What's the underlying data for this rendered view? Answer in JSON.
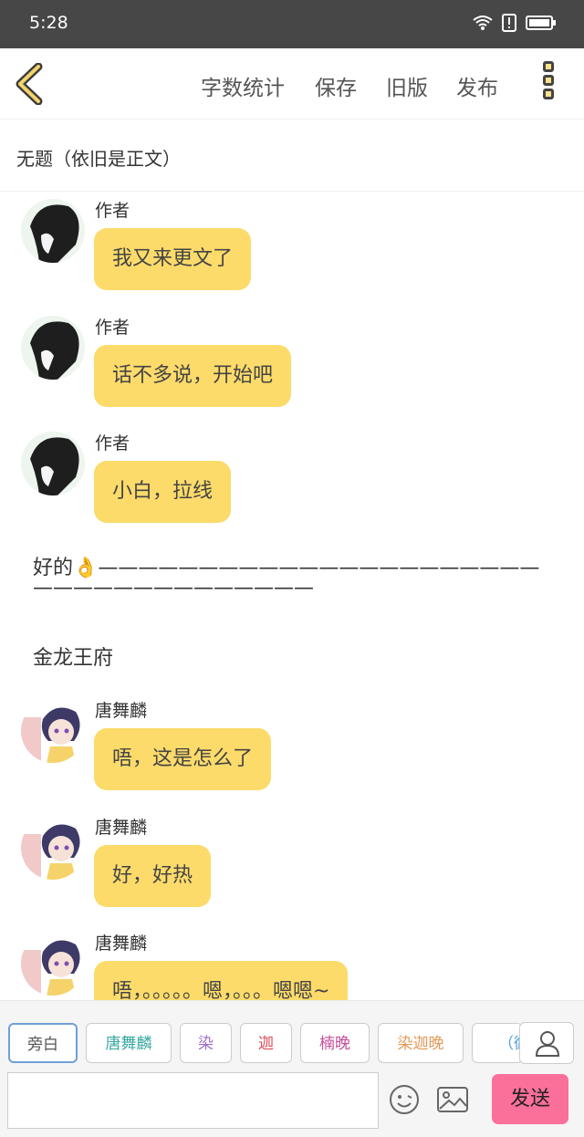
{
  "status_bar": {
    "time": "5:28"
  },
  "nav": {
    "word_count": "字数统计",
    "save": "保存",
    "old_version": "旧版",
    "publish": "发布"
  },
  "title": "无题（依旧是正文）",
  "messages": [
    {
      "speaker": "作者",
      "text": "我又来更文了"
    },
    {
      "speaker": "作者",
      "text": "话不多说，开始吧"
    },
    {
      "speaker": "作者",
      "text": "小白，拉线"
    }
  ],
  "narration": {
    "line1": "好的👌——————————————————————",
    "line2": "——————————————",
    "line3": "金龙王府"
  },
  "messages2": [
    {
      "speaker": "唐舞麟",
      "text": "唔，这是怎么了"
    },
    {
      "speaker": "唐舞麟",
      "text": "好，好热"
    },
    {
      "speaker": "唐舞麟",
      "text": "唔，。。。。。嗯，。。。嗯嗯~"
    }
  ],
  "roles": [
    {
      "label": "旁白",
      "color": "#555555"
    },
    {
      "label": "唐舞麟",
      "color": "#3aa8a0"
    },
    {
      "label": "染",
      "color": "#a06cc7"
    },
    {
      "label": "迦",
      "color": "#e0505a"
    },
    {
      "label": "楠晚",
      "color": "#c44d9a"
    },
    {
      "label": "染迦晚",
      "color": "#e39a5a"
    },
    {
      "label": "（御",
      "color": "#4a9fd8"
    }
  ],
  "composer": {
    "send": "发送",
    "placeholder": ""
  }
}
